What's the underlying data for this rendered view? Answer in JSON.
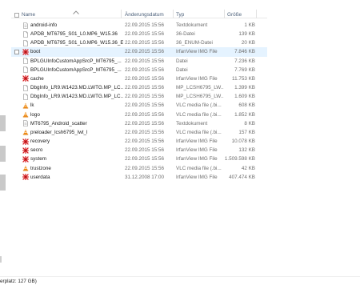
{
  "columns": {
    "name": "Name",
    "date": "Änderungsdatum",
    "type": "Typ",
    "size": "Größe"
  },
  "files": [
    {
      "name": "android-info",
      "date": "22.09.2015 15:56",
      "type": "Textdokument",
      "size": "1 KB",
      "icon": "text-document-icon"
    },
    {
      "name": "APDB_MT6795_S01_L0.MP6_W15.36",
      "date": "22.09.2015 15:56",
      "type": "36-Datei",
      "size": "139 KB",
      "icon": "file-icon"
    },
    {
      "name": "APDB_MT6795_S01_L0.MP6_W15.36_E...",
      "date": "22.09.2015 15:56",
      "type": "36_ENUM-Datei",
      "size": "20 KB",
      "icon": "file-icon"
    },
    {
      "name": "boot",
      "date": "22.09.2015 15:56",
      "type": "IrfanView IMG File",
      "size": "7.846 KB",
      "icon": "irfanview-icon"
    },
    {
      "name": "BPLGUInfoCustomAppSrcP_MT6795_...",
      "date": "22.09.2015 15:56",
      "type": "Datei",
      "size": "7.236 KB",
      "icon": "file-icon"
    },
    {
      "name": "BPLGUInfoCustomAppSrcP_MT6795_...",
      "date": "22.09.2015 15:56",
      "type": "Datei",
      "size": "7.769 KB",
      "icon": "file-icon"
    },
    {
      "name": "cache",
      "date": "22.09.2015 15:56",
      "type": "IrfanView IMG File",
      "size": "11.753 KB",
      "icon": "irfanview-icon"
    },
    {
      "name": "DbgInfo_LR9.W1423.MD.LWTG.MP_LC...",
      "date": "22.09.2015 15:56",
      "type": "MP_LCSH6795_LW...",
      "size": "1.399 KB",
      "icon": "file-icon"
    },
    {
      "name": "DbgInfo_LR9.W1423.MD.LWTG.MP_LC...",
      "date": "22.09.2015 15:56",
      "type": "MP_LCSH6795_LW...",
      "size": "1.609 KB",
      "icon": "file-icon"
    },
    {
      "name": "lk",
      "date": "22.09.2015 15:56",
      "type": "VLC media file (.bi...",
      "size": "608 KB",
      "icon": "vlc-cone-icon"
    },
    {
      "name": "logo",
      "date": "22.09.2015 15:56",
      "type": "VLC media file (.bi...",
      "size": "1.852 KB",
      "icon": "vlc-cone-icon"
    },
    {
      "name": "MT6795_Android_scatter",
      "date": "22.09.2015 15:56",
      "type": "Textdokument",
      "size": "8 KB",
      "icon": "text-document-icon"
    },
    {
      "name": "preloader_lcsh6795_lwt_l",
      "date": "22.09.2015 15:56",
      "type": "VLC media file (.bi...",
      "size": "157 KB",
      "icon": "vlc-cone-icon"
    },
    {
      "name": "recovery",
      "date": "22.09.2015 15:56",
      "type": "IrfanView IMG File",
      "size": "10.078 KB",
      "icon": "irfanview-icon"
    },
    {
      "name": "secro",
      "date": "22.09.2015 15:56",
      "type": "IrfanView IMG File",
      "size": "132 KB",
      "icon": "irfanview-icon"
    },
    {
      "name": "system",
      "date": "22.09.2015 15:56",
      "type": "IrfanView IMG File",
      "size": "1.509.598 KB",
      "icon": "irfanview-icon"
    },
    {
      "name": "trustzone",
      "date": "22.09.2015 15:56",
      "type": "VLC media file (.bi...",
      "size": "42 KB",
      "icon": "vlc-cone-icon"
    },
    {
      "name": "userdata",
      "date": "31.12.2008 17:00",
      "type": "IrfanView IMG File",
      "size": "407.474 KB",
      "icon": "irfanview-icon"
    }
  ],
  "hovered_row": 3,
  "status_bar": {
    "free_space": "erplatz: 127 GB)"
  },
  "colors": {
    "hover_row": "#e5f3ff",
    "header_text": "#4c607a",
    "irfanview_red": "#d8262a",
    "vlc_orange": "#f08a10"
  }
}
